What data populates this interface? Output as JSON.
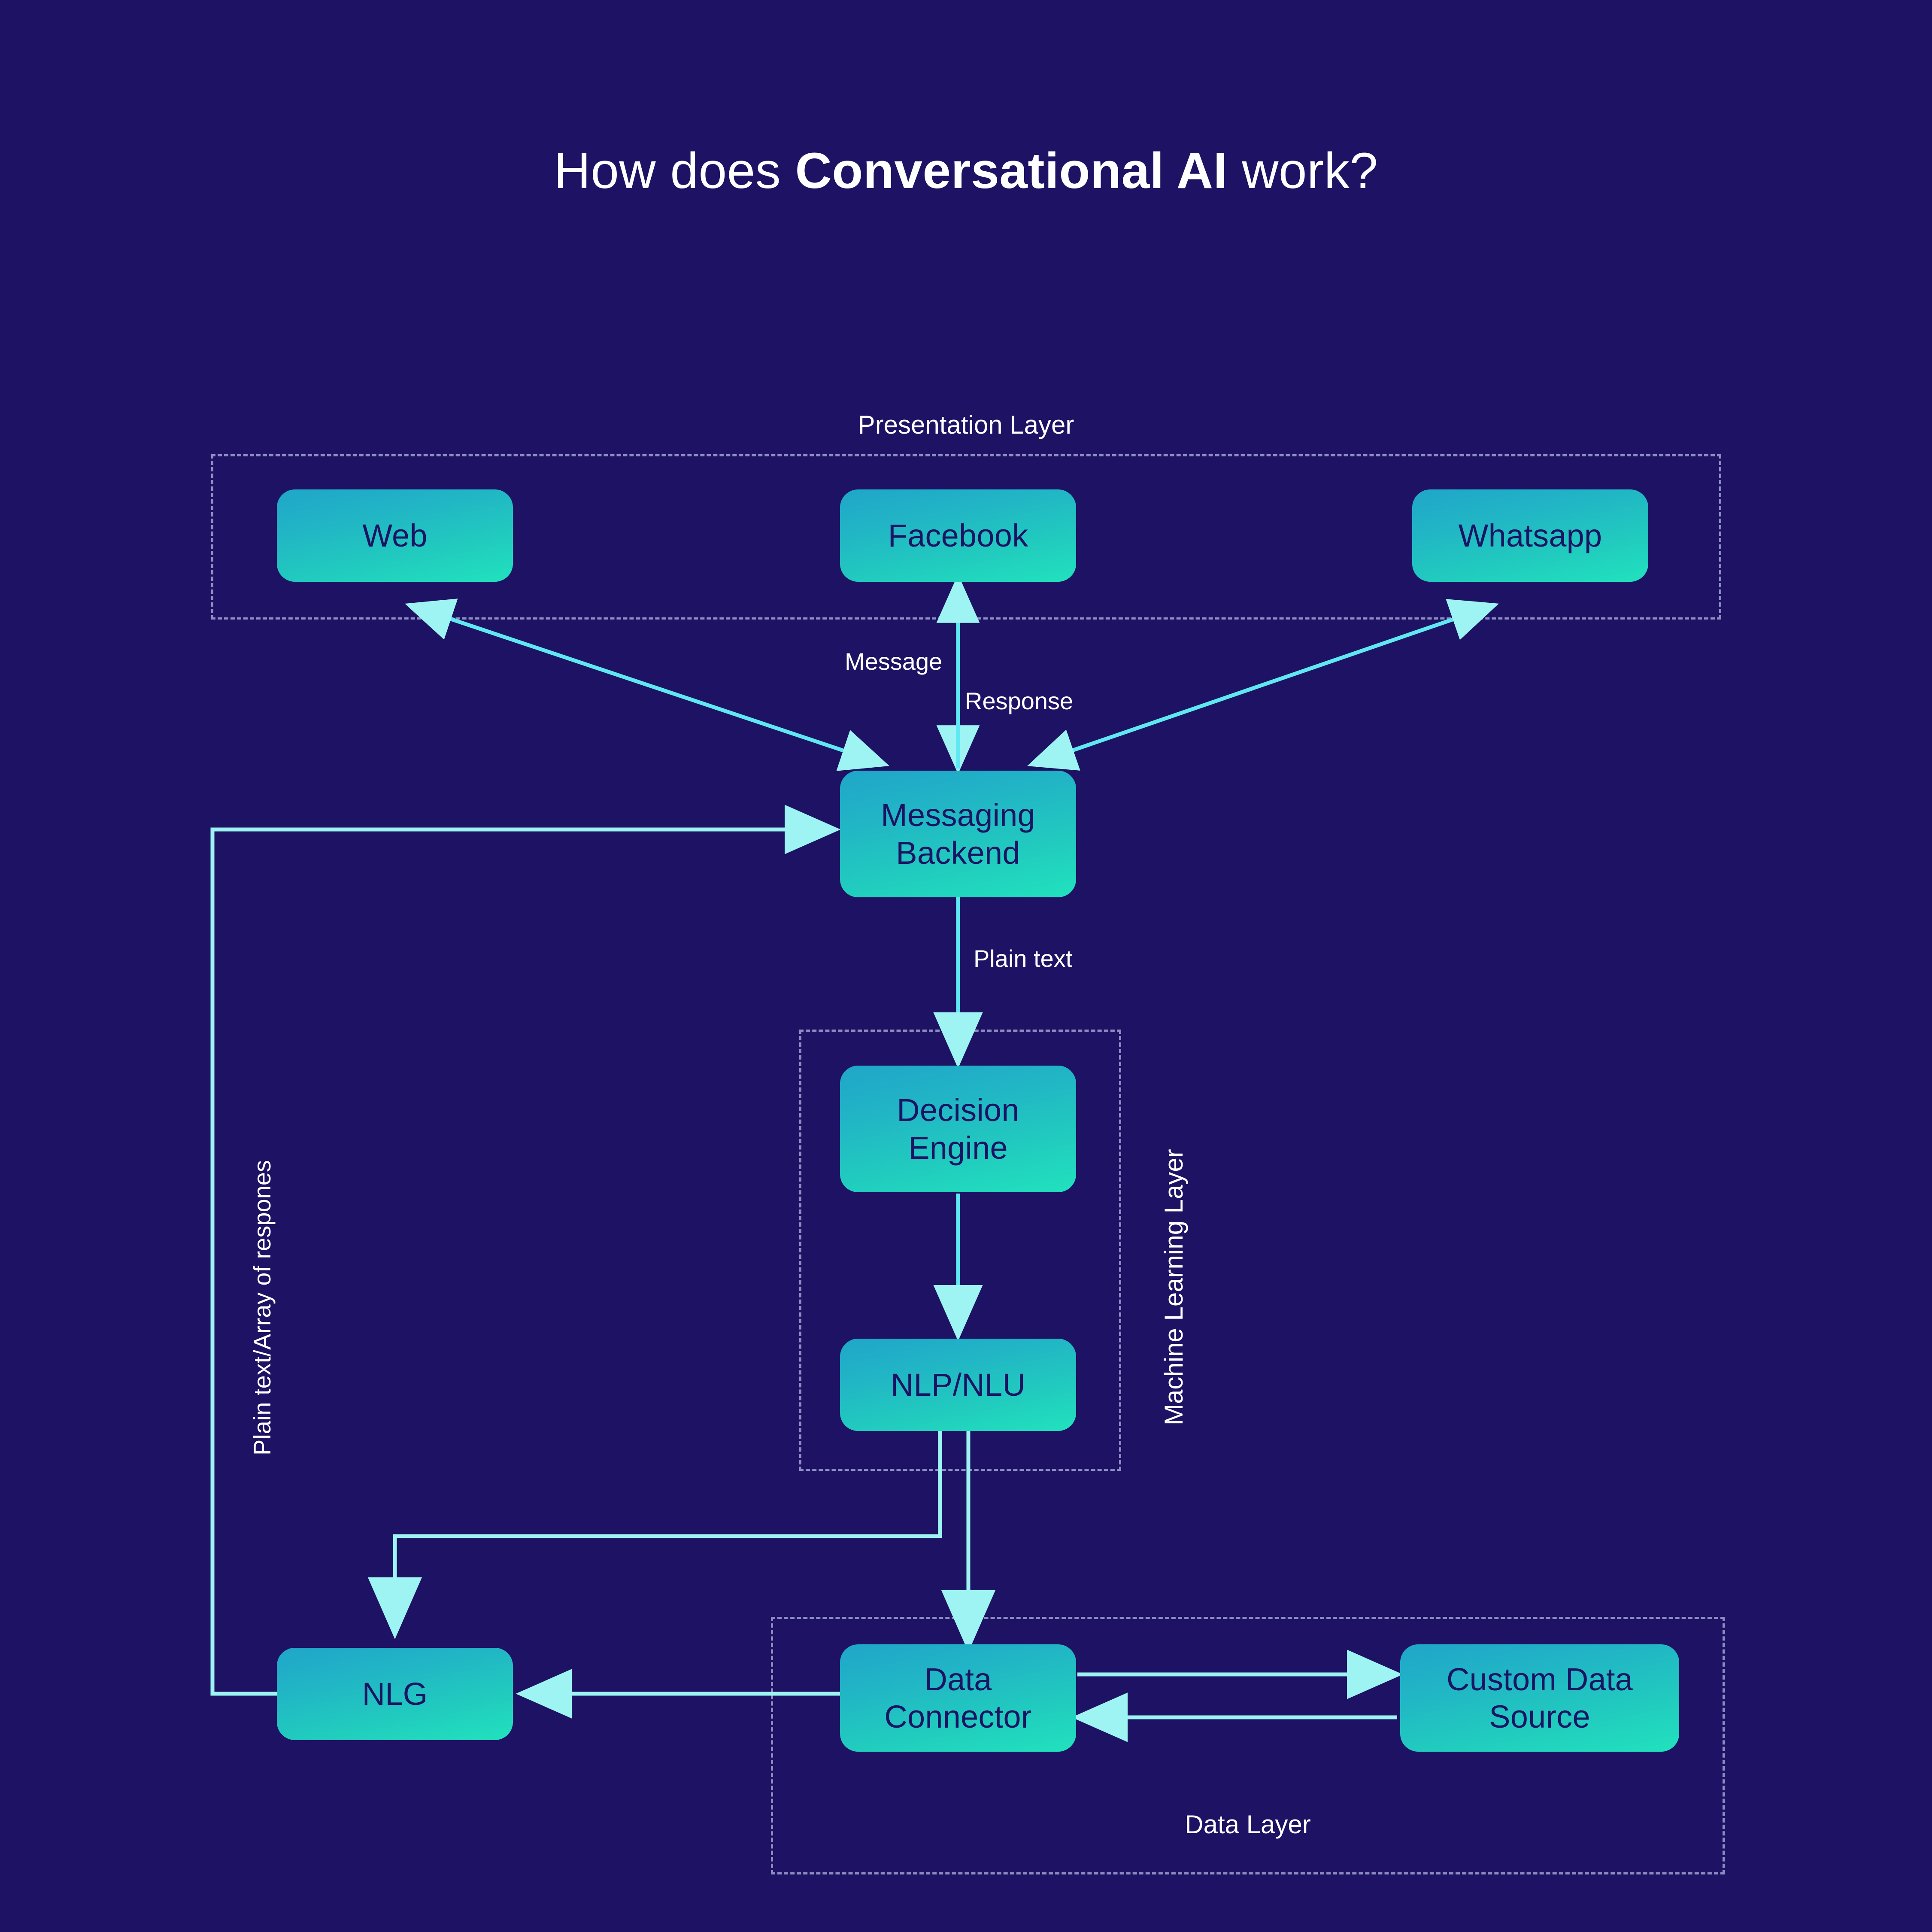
{
  "title": {
    "prefix": "How does ",
    "emphasis": "Conversational AI",
    "suffix": " work?"
  },
  "colors": {
    "background": "#1d1263",
    "node_gradient_start": "#1fa6c9",
    "node_gradient_end": "#21e2bd",
    "node_text": "#1b1464",
    "arrow": "#9ef4f2",
    "dashed_border": "#8d8dc2",
    "caption_text": "#ffffff"
  },
  "layers": [
    {
      "id": "presentation",
      "caption": "Presentation Layer",
      "orientation": "horizontal",
      "caption_position": "top"
    },
    {
      "id": "machine-learning",
      "caption": "Machine Learning Layer",
      "orientation": "vertical",
      "caption_position": "right"
    },
    {
      "id": "data",
      "caption": "Data Layer",
      "orientation": "horizontal",
      "caption_position": "bottom"
    }
  ],
  "nodes": [
    {
      "id": "web",
      "label": "Web",
      "layer": "presentation"
    },
    {
      "id": "facebook",
      "label": "Facebook",
      "layer": "presentation"
    },
    {
      "id": "whatsapp",
      "label": "Whatsapp",
      "layer": "presentation"
    },
    {
      "id": "messaging",
      "label_line1": "Messaging",
      "label_line2": "Backend",
      "layer": "none"
    },
    {
      "id": "decision",
      "label_line1": "Decision",
      "label_line2": "Engine",
      "layer": "machine-learning"
    },
    {
      "id": "nlp",
      "label": "NLP/NLU",
      "layer": "machine-learning"
    },
    {
      "id": "nlg",
      "label": "NLG",
      "layer": "none"
    },
    {
      "id": "connector",
      "label_line1": "Data",
      "label_line2": "Connector",
      "layer": "data"
    },
    {
      "id": "custom-source",
      "label_line1": "Custom Data",
      "label_line2": "Source",
      "layer": "data"
    }
  ],
  "edge_labels": {
    "message": "Message",
    "response": "Response",
    "plain_text": "Plain text",
    "plain_text_array": "Plain text/Array of respones"
  },
  "edges": [
    {
      "from": "web",
      "to": "messaging",
      "bidirectional": true,
      "label": ""
    },
    {
      "from": "facebook",
      "to": "messaging",
      "bidirectional": true,
      "label": "Message"
    },
    {
      "from": "messaging",
      "to": "facebook",
      "bidirectional": false,
      "label": "Response"
    },
    {
      "from": "whatsapp",
      "to": "messaging",
      "bidirectional": true,
      "label": ""
    },
    {
      "from": "messaging",
      "to": "decision",
      "bidirectional": false,
      "label": "Plain text"
    },
    {
      "from": "decision",
      "to": "nlp",
      "bidirectional": false,
      "label": ""
    },
    {
      "from": "nlp",
      "to": "nlg",
      "bidirectional": false,
      "label": ""
    },
    {
      "from": "nlp",
      "to": "connector",
      "bidirectional": false,
      "label": ""
    },
    {
      "from": "connector",
      "to": "nlg",
      "bidirectional": false,
      "label": ""
    },
    {
      "from": "connector",
      "to": "custom-source",
      "bidirectional": false,
      "label": ""
    },
    {
      "from": "custom-source",
      "to": "connector",
      "bidirectional": false,
      "label": ""
    },
    {
      "from": "nlg",
      "to": "messaging",
      "bidirectional": false,
      "label": "Plain text/Array of respones"
    }
  ]
}
